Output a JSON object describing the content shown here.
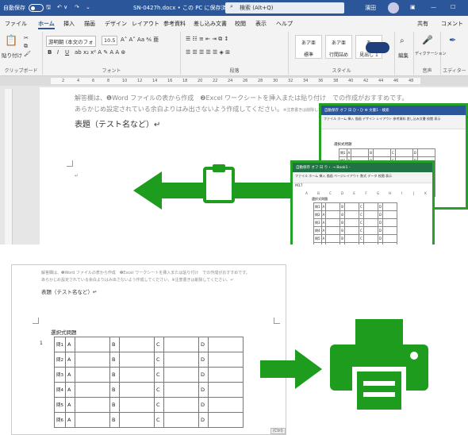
{
  "word": {
    "title_bar": {
      "autosave": "自動保存",
      "toggle": "オフ",
      "doc_name": "SN-0427h.docx • この PC に保存済み ∨",
      "search": "検索 (Alt+Q)",
      "user": "濱田"
    },
    "menu": [
      "ファイル",
      "ホーム",
      "挿入",
      "描画",
      "デザイン",
      "レイアウト",
      "参考資料",
      "差し込み文書",
      "校閲",
      "表示",
      "ヘルプ"
    ],
    "menu_right": [
      "共有",
      "コメント"
    ],
    "ribbon": {
      "clipboard": {
        "paste": "貼り付け",
        "label": "クリップボード"
      },
      "font": {
        "name": "游明朝 (本文のフォ",
        "size": "10.5",
        "label": "フォント"
      },
      "paragraph": {
        "label": "段落"
      },
      "styles": {
        "items": [
          "あア亜",
          "あア亜",
          "あ"
        ],
        "subs": [
          "標準",
          "行間詰め",
          "見出し 1"
        ],
        "label": "スタイル"
      },
      "editing": {
        "label": "編集"
      },
      "dictation": {
        "label": "ディクテーション",
        "group": "音声"
      },
      "editor": {
        "label": "エディター"
      }
    },
    "ruler_ticks": [
      "2",
      "4",
      "6",
      "8",
      "10",
      "12",
      "14",
      "16",
      "18",
      "20",
      "22",
      "24",
      "26",
      "28",
      "30",
      "32",
      "34",
      "36",
      "38",
      "40",
      "42",
      "44",
      "46",
      "48"
    ],
    "doc_lines": [
      "解答欄は、❶Word ファイルの表から作成　❷Excel ワークシートを挿入または貼り付け　での作成がおすすめです。",
      "あらかじめ設定されている余白よりはみ出さないよう作成してください。"
    ],
    "doc_note": "※注意書きは削除してください。",
    "heading": "表題（テスト名など）↵"
  },
  "mini_word": {
    "title": "自動保存 オフ 日 ひ・ひ ⚙ 文書1 - 検索",
    "menu": "ファイル ホーム 挿入 描画 デザイン レイアウト 参考資料 差し込み文書 校閲 表示",
    "table_title": "選択式問題",
    "rows": [
      "問1",
      "問2",
      "問3",
      "問4",
      "問5",
      "問6"
    ]
  },
  "mini_excel": {
    "title": "自動保存 オフ 日 り・ → Book1 -",
    "menu": "ファイル ホーム 挿入 描画 ページレイアウト 数式 データ 校閲 表示",
    "cell_ref": "M17",
    "cols": [
      "A",
      "B",
      "C",
      "D",
      "E",
      "F",
      "G",
      "H",
      "I",
      "J",
      "K"
    ],
    "table_title": "選択式問題",
    "rows": [
      "問1",
      "問2",
      "問3",
      "問4",
      "問5",
      "問6"
    ]
  },
  "print_doc": {
    "lines": [
      "解答欄は、❶Word ファイルの表から作成　❷Excel ワークシートを挿入または貼り付け　での作成がおすすめです。",
      "あらかじめ設定されている余白よりはみ出さないよう作成してください。※注意書きは削除してください。↵"
    ],
    "heading": "表題（テスト名など）↵",
    "table_title": "選択式問題",
    "row_label": "1",
    "rows": [
      "問1",
      "問2",
      "問3",
      "問4",
      "問5",
      "問6"
    ],
    "choices": [
      "A",
      "B",
      "C",
      "D"
    ],
    "ctrl": "(Ctrl)"
  },
  "colors": {
    "word_blue": "#2b579a",
    "excel_green": "#217346",
    "accent_green": "#1e9c1e"
  },
  "icons": {
    "clipboard": "clipboard-icon",
    "printer": "printer-icon"
  }
}
